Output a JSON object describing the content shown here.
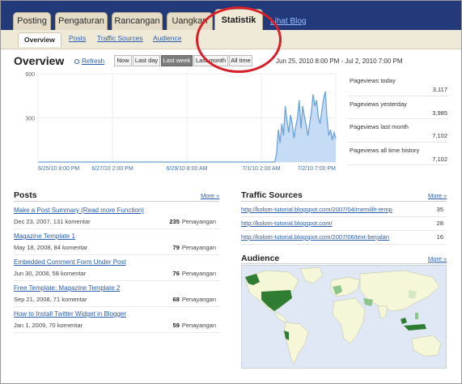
{
  "tabs": [
    {
      "label": "Posting"
    },
    {
      "label": "Pengaturan"
    },
    {
      "label": "Rancangan"
    },
    {
      "label": "Uangkan"
    },
    {
      "label": "Statistik"
    }
  ],
  "view_blog": "Lihat Blog",
  "subtabs": [
    {
      "label": "Overview"
    },
    {
      "label": "Posts"
    },
    {
      "label": "Traffic Sources"
    },
    {
      "label": "Audience"
    }
  ],
  "overview": {
    "title": "Overview",
    "refresh": "Refresh",
    "ranges": [
      "Now",
      "Last day",
      "Last week",
      "Last month",
      "All time"
    ],
    "selected_range": "Last week",
    "date_range": "Jun 25, 2010 8:00 PM - Jul 2, 2010 7:00 PM"
  },
  "chart_data": {
    "type": "area",
    "y_ticks": [
      "600",
      "300"
    ],
    "ylim": [
      0,
      600
    ],
    "x_labels": [
      "6/25/10 8:00 PM",
      "6/27/10 2:00 PM",
      "6/29/10 8:00 AM",
      "7/1/10 2:00 AM",
      "7/2/10 7:00 PM"
    ],
    "x_start_index": 0,
    "x_end_index": 168,
    "values": [
      0,
      0,
      0,
      0,
      0,
      0,
      0,
      0,
      0,
      0,
      0,
      0,
      0,
      0,
      0,
      0,
      0,
      0,
      0,
      0,
      0,
      0,
      0,
      0,
      0,
      0,
      0,
      0,
      0,
      0,
      0,
      0,
      0,
      0,
      0,
      0,
      0,
      0,
      0,
      0,
      0,
      0,
      0,
      0,
      0,
      0,
      0,
      0,
      0,
      0,
      0,
      0,
      0,
      0,
      0,
      0,
      0,
      0,
      0,
      0,
      0,
      0,
      0,
      0,
      0,
      0,
      0,
      0,
      0,
      0,
      0,
      0,
      0,
      0,
      0,
      0,
      0,
      0,
      0,
      0,
      0,
      0,
      0,
      0,
      0,
      0,
      0,
      0,
      0,
      0,
      0,
      0,
      0,
      0,
      0,
      0,
      0,
      0,
      0,
      0,
      0,
      0,
      0,
      0,
      0,
      0,
      0,
      0,
      0,
      0,
      0,
      0,
      0,
      0,
      0,
      0,
      0,
      0,
      0,
      0,
      0,
      0,
      0,
      0,
      0,
      0,
      0,
      0,
      0,
      0,
      0,
      0,
      0,
      0,
      0,
      0,
      0,
      60,
      220,
      130,
      260,
      180,
      380,
      280,
      200,
      320,
      260,
      160,
      240,
      300,
      420,
      230,
      380,
      310,
      250,
      180,
      260,
      340,
      460,
      380,
      420,
      300,
      260,
      350,
      430,
      480,
      290,
      180,
      220,
      150,
      200,
      160
    ],
    "line_color": "#6aa3dd",
    "fill_color": "#c5dcf4"
  },
  "stats": [
    {
      "label": "Pageviews today",
      "value": "3,117"
    },
    {
      "label": "Pageviews yesterday",
      "value": "3,985"
    },
    {
      "label": "Pageviews last month",
      "value": "7,102"
    },
    {
      "label": "Pageviews all time history",
      "value": "7,102"
    }
  ],
  "posts": {
    "title": "Posts",
    "more": "More »",
    "items": [
      {
        "title": "Make a Post Summary (Read more Function)",
        "meta": "Dec 23, 2007, 131 komentar",
        "views": "235",
        "views_label": "Penayangan"
      },
      {
        "title": "Magazine Template 1",
        "meta": "May 18, 2008, 84 komentar",
        "views": "79",
        "views_label": "Penayangan"
      },
      {
        "title": "Embedded Comment Form Under Post",
        "meta": "Jun 30, 2008, 58 komentar",
        "views": "76",
        "views_label": "Penayangan"
      },
      {
        "title": "Free Template: Magazine Template 2",
        "meta": "Sep 21, 2008, 71 komentar",
        "views": "68",
        "views_label": "Penayangan"
      },
      {
        "title": "How to Install Twitter Widget in Blogger",
        "meta": "Jan 1, 2009, 70 komentar",
        "views": "59",
        "views_label": "Penayangan"
      }
    ]
  },
  "traffic": {
    "title": "Traffic Sources",
    "more": "More »",
    "items": [
      {
        "url": "http://kolom-tutorial.blogspot.com/2007/04/memilih-temp",
        "count": "35"
      },
      {
        "url": "http://kolom-tutorial.blogspot.com/",
        "count": "28"
      },
      {
        "url": "http://kolom-tutorial.blogspot.com/2007/06/text-berjalan",
        "count": "16"
      }
    ]
  },
  "audience": {
    "title": "Audience",
    "more": "More »"
  },
  "colors": {
    "topbar": "#22397a",
    "tab": "#e4dcc6",
    "link": "#2a5db0",
    "map_land": "#f6f6d8",
    "map_high": "#2f7d33",
    "map_mid": "#8cc58a",
    "annotation": "#d8202a"
  }
}
